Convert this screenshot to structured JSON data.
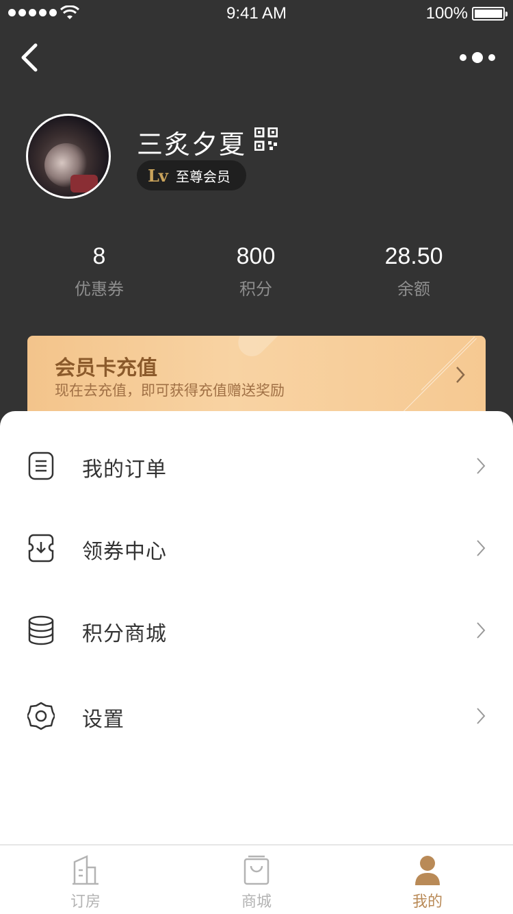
{
  "status_bar": {
    "time": "9:41 AM",
    "battery": "100%"
  },
  "profile": {
    "name": "三炙夕夏",
    "level_badge": "Lv",
    "member_label": "至尊会员"
  },
  "stats": [
    {
      "value": "8",
      "label": "优惠券"
    },
    {
      "value": "800",
      "label": "积分"
    },
    {
      "value": "28.50",
      "label": "余额"
    }
  ],
  "recharge": {
    "title": "会员卡充值",
    "subtitle": "现在去充值，即可获得充值赠送奖励"
  },
  "menu": [
    {
      "label": "我的订单",
      "icon": "order-list-icon"
    },
    {
      "label": "领券中心",
      "icon": "coupon-download-icon"
    },
    {
      "label": "积分商城",
      "icon": "points-stack-icon"
    },
    {
      "label": "设置",
      "icon": "gear-icon"
    }
  ],
  "tabs": [
    {
      "label": "订房",
      "icon": "building-icon",
      "active": false
    },
    {
      "label": "商城",
      "icon": "shopping-bag-icon",
      "active": false
    },
    {
      "label": "我的",
      "icon": "user-icon",
      "active": true
    }
  ],
  "colors": {
    "header_bg": "#333333",
    "accent": "#b98a57",
    "card_gold": "#f6c992"
  }
}
